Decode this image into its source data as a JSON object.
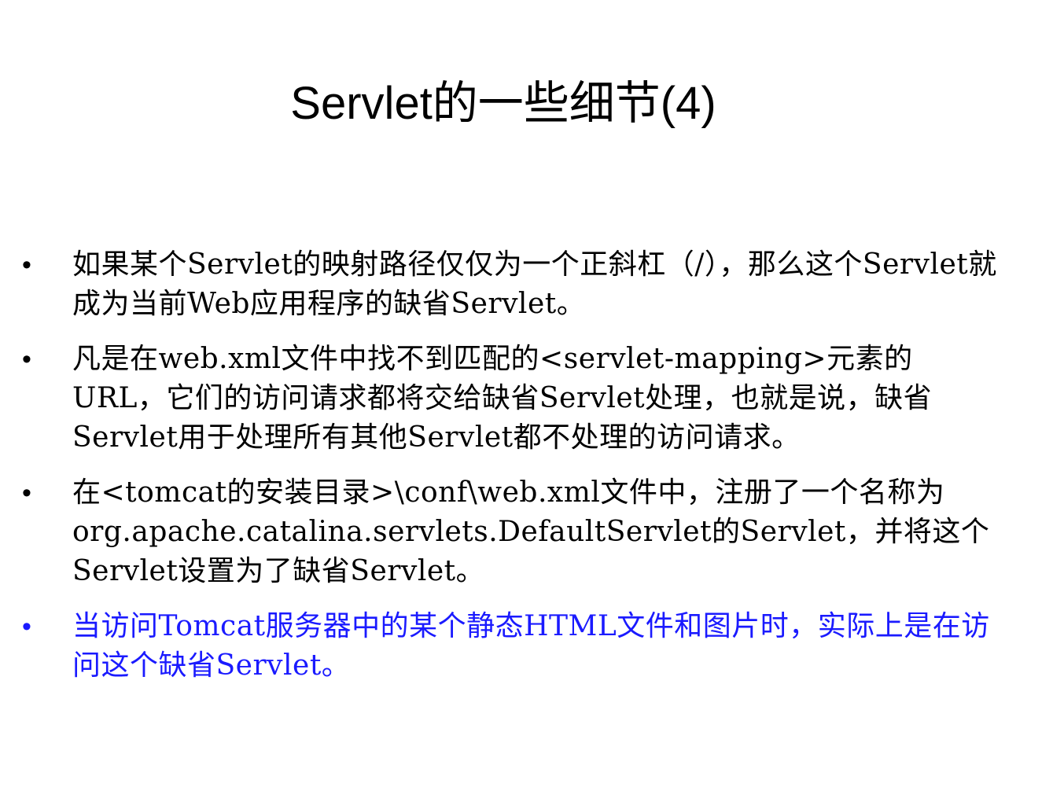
{
  "slide": {
    "title": "Servlet的一些细节(4)",
    "bullet_symbol": "•",
    "bullets": [
      {
        "text": "如果某个Servlet的映射路径仅仅为一个正斜杠（/），那么这个Servlet就成为当前Web应用程序的缺省Servlet。"
      },
      {
        "text": "凡是在web.xml文件中找不到匹配的<servlet-mapping>元素的URL，它们的访问请求都将交给缺省Servlet处理，也就是说，缺省Servlet用于处理所有其他Servlet都不处理的访问请求。"
      },
      {
        "text": "在<tomcat的安装目录>\\conf\\web.xml文件中，注册了一个名称为org.apache.catalina.servlets.DefaultServlet的Servlet，并将这个Servlet设置为了缺省Servlet。"
      },
      {
        "text": "当访问Tomcat服务器中的某个静态HTML文件和图片时，实际上是在访问这个缺省Servlet。"
      }
    ]
  },
  "colors": {
    "text": "#000000",
    "highlight": "#1a1aff",
    "background": "#ffffff"
  }
}
